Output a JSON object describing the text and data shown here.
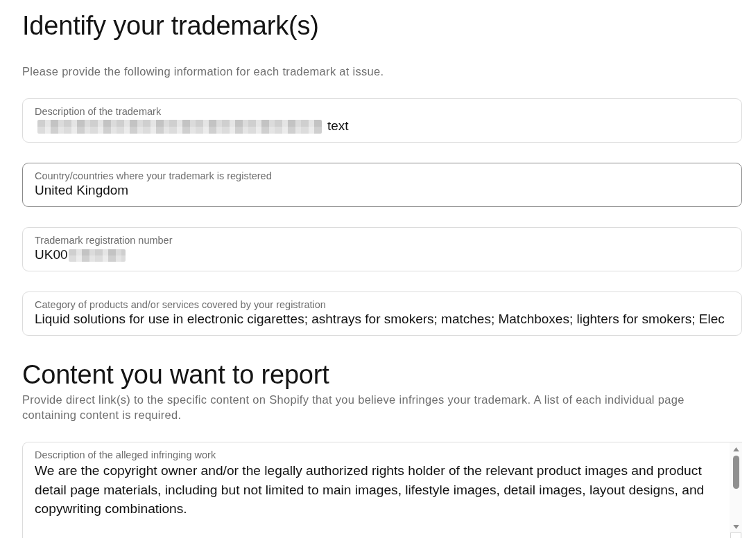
{
  "sections": [
    {
      "title": "Identify your trademark(s)",
      "description": "Please provide the following information for each trademark at issue.",
      "fields": [
        {
          "kind": "input",
          "label": "Description of the trademark",
          "focused": false,
          "value_parts": [
            {
              "kind": "redacted"
            },
            {
              "kind": "text",
              "text": "text"
            }
          ]
        },
        {
          "kind": "input",
          "label": "Country/countries where your trademark is registered",
          "focused": true,
          "value_parts": [
            {
              "kind": "text",
              "text": "United Kingdom"
            }
          ]
        },
        {
          "kind": "input",
          "label": "Trademark registration number",
          "focused": false,
          "value_parts": [
            {
              "kind": "text",
              "text": "UK00"
            },
            {
              "kind": "redacted"
            }
          ]
        },
        {
          "kind": "input",
          "label": "Category of products and/or services covered by your registration",
          "focused": false,
          "value_parts": [
            {
              "kind": "text",
              "text": "Liquid solutions for use in electronic cigarettes; ashtrays for smokers; matches; Matchboxes; lighters for smokers; Elec"
            }
          ]
        }
      ]
    },
    {
      "title": "Content you want to report",
      "description": "Provide direct link(s) to the specific content on Shopify that you believe infringes your trademark. A list of each individual page containing content is required.",
      "fields": [
        {
          "kind": "textarea",
          "label": "Description of the alleged infringing work",
          "focused": false,
          "value_parts": [
            {
              "kind": "text",
              "text": "We are the copyright owner and/or the legally authorized rights holder of the relevant product images and product detail page materials, including but not limited to main images, lifestyle images, detail images, layout designs, and copywriting combinations."
            }
          ]
        }
      ]
    }
  ]
}
